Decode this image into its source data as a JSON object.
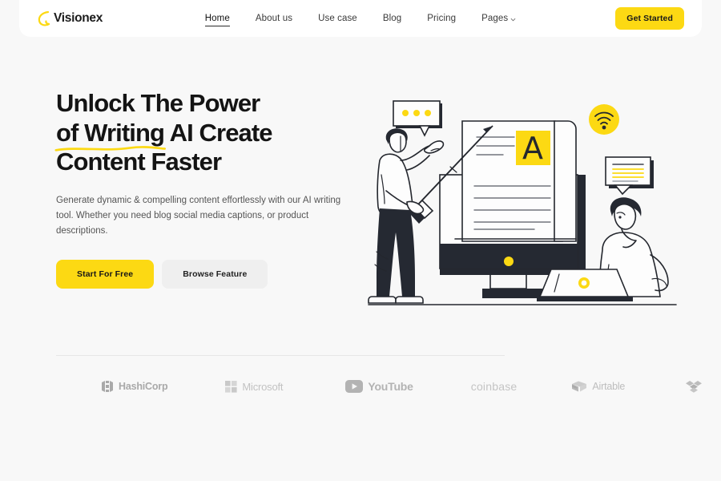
{
  "theme": {
    "accent": "#FCD913",
    "ink": "#141414",
    "page_bg": "#F8F8F8",
    "nav_bg": "#FFFFFF",
    "muted_text": "#555555",
    "logo_grey": "#B9B9B9"
  },
  "navbar": {
    "brand": {
      "name": "Visionex",
      "mark": "swoosh-icon"
    },
    "links": [
      {
        "label": "Home",
        "active": true,
        "icon": null
      },
      {
        "label": "About us",
        "active": false,
        "icon": null
      },
      {
        "label": "Use case",
        "active": false,
        "icon": null
      },
      {
        "label": "Blog",
        "active": false,
        "icon": null
      },
      {
        "label": "Pricing",
        "active": false,
        "icon": null
      },
      {
        "label": "Pages",
        "active": false,
        "icon": "chevron-down-icon"
      }
    ],
    "cta": {
      "label": "Get Started"
    }
  },
  "hero": {
    "headline_lines": [
      "Unlock The Power",
      "of Writing AI Create",
      "Content Faster"
    ],
    "headline_underline_word": "of Writing",
    "subtitle": "Generate dynamic & compelling content effortlessly with our AI writing tool. Whether you need blog social media captions, or product descriptions.",
    "buttons": [
      {
        "label": "Start For Free",
        "style": "primary"
      },
      {
        "label": "Browse Feature",
        "style": "secondary"
      }
    ],
    "illustration": {
      "name": "ai-writing-illustration",
      "elements": [
        "person-pointing",
        "giant-pencil",
        "desktop-monitor",
        "document-page",
        "letter-A-tile",
        "chat-bubble-dots",
        "wifi-badge",
        "chat-bubble-lines",
        "person-at-laptop",
        "laptop"
      ],
      "letter_tile": "A"
    }
  },
  "logos": {
    "items": [
      {
        "name": "HashiCorp",
        "icon": "hashicorp-icon"
      },
      {
        "name": "Microsoft",
        "icon": "microsoft-icon"
      },
      {
        "name": "YouTube",
        "icon": "youtube-icon"
      },
      {
        "name": "coinbase",
        "icon": "coinbase-wordmark"
      },
      {
        "name": "Airtable",
        "icon": "airtable-icon"
      },
      {
        "name": "",
        "icon": "dropbox-icon"
      }
    ]
  }
}
